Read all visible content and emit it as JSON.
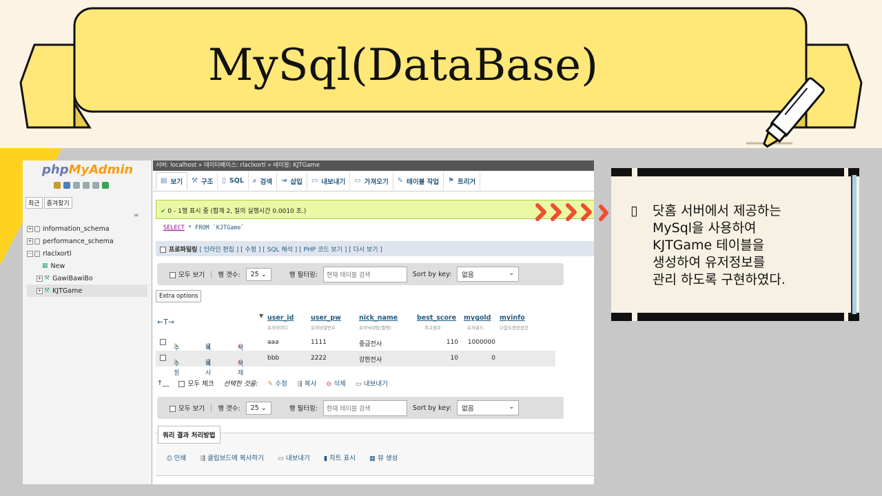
{
  "slide": {
    "title": "MySql(DataBase)",
    "note_bullet": "▯",
    "note_text": "닷홈 서버에서 제공하는\nMySql을 사용하여\nKJTGame 테이블을\n생성하여 유저정보를\n관리 하도록 구현하였다."
  },
  "colors": {
    "banner": "#ffe778",
    "accent_triangle": "#ffd21f",
    "chevron": "#f04e2e",
    "note_side": "#aad2e6"
  },
  "pma": {
    "logo_php": "php",
    "logo_my": "MyAdmin",
    "side_tabs": [
      "최근",
      "즐겨찾기"
    ],
    "tree": [
      {
        "label": "information_schema"
      },
      {
        "label": "performance_schema"
      },
      {
        "label": "rlaclxortl"
      },
      {
        "label": "New"
      },
      {
        "label": "GawiBawiBo"
      },
      {
        "label": "KJTGame"
      }
    ],
    "breadcrumb": "서버: localhost » 데이터베이스: rlaclxortl » 테이블: KJTGame",
    "tabs": [
      "보기",
      "구조",
      "SQL",
      "검색",
      "삽입",
      "내보내기",
      "가져오기",
      "테이블 작업",
      "트리거"
    ],
    "success_msg": "0 - 1행 표시 중 (합계 2, 질의 실행시간 0.0010 초.)",
    "sql_select": "SELECT",
    "sql_rest": " * FROM `KJTGame`",
    "profiling": "프로파일링",
    "prof_links": "[ 인라인 편집 ] [ 수정 ] [ SQL 해석 ] [ PHP 코드 보기 ] [ 다시 보기 ]",
    "nav": {
      "show_all": "모두 보기",
      "rows_label": "행 갯수:",
      "rows_value": "25",
      "filter_label": "행 필터링:",
      "filter_placeholder": "현재 테이블 검색",
      "sort_label": "Sort by key:",
      "sort_value": "없음"
    },
    "extra_options": "Extra options",
    "arrows": "←T→",
    "columns": [
      {
        "name": "user_id",
        "comment": "유저아이디"
      },
      {
        "name": "user_pw",
        "comment": "유저비밀번호"
      },
      {
        "name": "nick_name",
        "comment": "유저닉네임(별명)"
      },
      {
        "name": "best_score",
        "comment": "최고점수"
      },
      {
        "name": "mygold",
        "comment": "유저골드"
      },
      {
        "name": "myinfo",
        "comment": "다음도전장공간"
      }
    ],
    "row_actions": {
      "edit": "수정",
      "copy": "복사",
      "delete": "삭제"
    },
    "rows": [
      {
        "user_id": "aaa",
        "user_pw": "1111",
        "nick_name": "중급전사",
        "best_score": "110",
        "mygold": "1000000"
      },
      {
        "user_id": "bbb",
        "user_pw": "2222",
        "nick_name": "강한전사",
        "best_score": "10",
        "mygold": "0"
      }
    ],
    "bulk": {
      "check_all": "모두 체크",
      "selected": "선택한 것을:",
      "edit": "수정",
      "copy": "복사",
      "delete": "삭제",
      "export": "내보내기"
    },
    "query_title": "쿼리 결과 처리방법",
    "query_ops": [
      "인쇄",
      "클립보드에 복사하기",
      "내보내기",
      "차트 표시",
      "뷰 생성"
    ]
  }
}
